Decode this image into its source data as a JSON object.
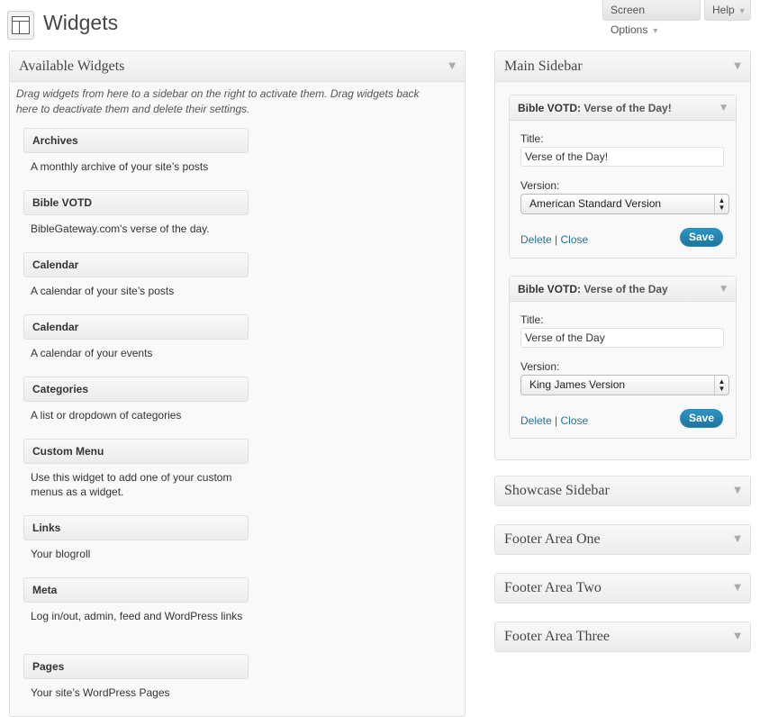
{
  "header": {
    "title": "Widgets",
    "screen_options": "Screen Options",
    "help": "Help"
  },
  "available": {
    "title": "Available Widgets",
    "description": "Drag widgets from here to a sidebar on the right to activate them. Drag widgets back here to deactivate them and delete their settings.",
    "widgets": [
      {
        "title": "Archives",
        "desc": "A monthly archive of your site’s posts"
      },
      {
        "title": "Bible VOTD",
        "desc": "BibleGateway.com's verse of the day."
      },
      {
        "title": "Calendar",
        "desc": "A calendar of your site’s posts"
      },
      {
        "title": "Calendar",
        "desc": "A calendar of your events"
      },
      {
        "title": "Categories",
        "desc": "A list or dropdown of categories"
      },
      {
        "title": "Custom Menu",
        "desc": "Use this widget to add one of your custom menus as a widget."
      },
      {
        "title": "Links",
        "desc": "Your blogroll"
      },
      {
        "title": "Meta",
        "desc": "Log in/out, admin, feed and WordPress links"
      },
      {
        "title": "Pages",
        "desc": "Your site’s WordPress Pages"
      }
    ]
  },
  "main_sidebar": {
    "title": "Main Sidebar",
    "widgets": [
      {
        "name": "Bible VOTD",
        "instance_title": "Verse of the Day!",
        "title_label": "Title:",
        "title_value": "Verse of the Day!",
        "version_label": "Version:",
        "version_value": "American Standard Version",
        "delete": "Delete",
        "close": "Close",
        "separator": "|",
        "save": "Save"
      },
      {
        "name": "Bible VOTD",
        "instance_title": "Verse of the Day",
        "title_label": "Title:",
        "title_value": "Verse of the Day",
        "version_label": "Version:",
        "version_value": "King James Version",
        "delete": "Delete",
        "close": "Close",
        "separator": "|",
        "save": "Save"
      }
    ]
  },
  "sidebars": {
    "showcase": "Showcase Sidebar",
    "footer_one": "Footer Area One",
    "footer_two": "Footer Area Two",
    "footer_three": "Footer Area Three"
  },
  "icons": {
    "toggle": "triangle-down-icon",
    "select_stepper": "up-down-arrows-icon"
  },
  "colors": {
    "link": "#21759b",
    "save_button": "#21759b"
  }
}
